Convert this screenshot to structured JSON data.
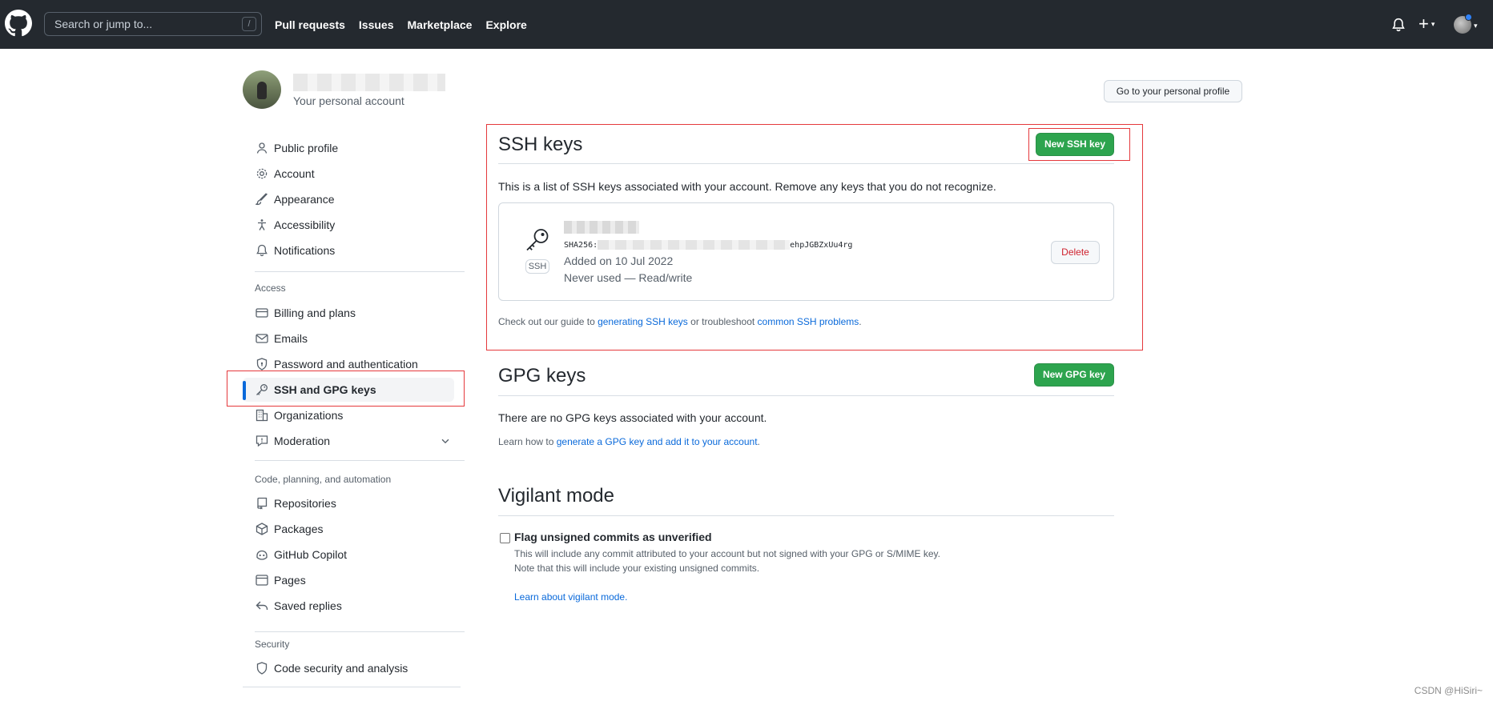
{
  "header": {
    "search_placeholder": "Search or jump to...",
    "search_shortcut": "/",
    "nav": [
      "Pull requests",
      "Issues",
      "Marketplace",
      "Explore"
    ],
    "plus_label": "+",
    "caret": "▾"
  },
  "account": {
    "subtitle": "Your personal account",
    "go_profile": "Go to your personal profile"
  },
  "sidebar": {
    "items_top": [
      {
        "label": "Public profile",
        "icon": "person-icon"
      },
      {
        "label": "Account",
        "icon": "gear-icon"
      },
      {
        "label": "Appearance",
        "icon": "paintbrush-icon"
      },
      {
        "label": "Accessibility",
        "icon": "accessibility-icon"
      },
      {
        "label": "Notifications",
        "icon": "bell-icon"
      }
    ],
    "group_access": "Access",
    "items_access": [
      {
        "label": "Billing and plans",
        "icon": "credit-card-icon"
      },
      {
        "label": "Emails",
        "icon": "mail-icon"
      },
      {
        "label": "Password and authentication",
        "icon": "shield-lock-icon"
      },
      {
        "label": "SSH and GPG keys",
        "icon": "key-icon"
      },
      {
        "label": "Organizations",
        "icon": "organization-icon"
      },
      {
        "label": "Moderation",
        "icon": "report-icon"
      }
    ],
    "group_code": "Code, planning, and automation",
    "items_code": [
      {
        "label": "Repositories",
        "icon": "repo-icon"
      },
      {
        "label": "Packages",
        "icon": "package-icon"
      },
      {
        "label": "GitHub Copilot",
        "icon": "copilot-icon"
      },
      {
        "label": "Pages",
        "icon": "browser-icon"
      },
      {
        "label": "Saved replies",
        "icon": "reply-icon"
      }
    ],
    "group_security": "Security",
    "items_security": [
      {
        "label": "Code security and analysis",
        "icon": "shield-icon"
      }
    ],
    "active": "SSH and GPG keys"
  },
  "ssh": {
    "title": "SSH keys",
    "new_button": "New SSH key",
    "description": "This is a list of SSH keys associated with your account. Remove any keys that you do not recognize.",
    "key": {
      "badge": "SSH",
      "fingerprint_prefix": "SHA256:",
      "fingerprint_suffix": "ehpJGBZxUu4rg",
      "added": "Added on 10 Jul 2022",
      "usage": "Never used — Read/write",
      "delete": "Delete"
    },
    "footer_pre": "Check out our guide to ",
    "footer_link1": "generating SSH keys",
    "footer_mid": " or troubleshoot ",
    "footer_link2": "common SSH problems",
    "footer_post": "."
  },
  "gpg": {
    "title": "GPG keys",
    "new_button": "New GPG key",
    "empty": "There are no GPG keys associated with your account.",
    "learn_pre": "Learn how to ",
    "learn_link": "generate a GPG key and add it to your account",
    "learn_post": "."
  },
  "vigilant": {
    "title": "Vigilant mode",
    "checkbox_label": "Flag unsigned commits as unverified",
    "checked": false,
    "desc1": "This will include any commit attributed to your account but not signed with your GPG or S/MIME key.",
    "desc2": "Note that this will include your existing unsigned commits.",
    "learn_link": "Learn about vigilant mode."
  },
  "watermark": "CSDN @HiSiri~",
  "colors": {
    "header_bg": "#24292f",
    "primary_button": "#2da44e",
    "link": "#0969da",
    "danger": "#cf222e",
    "annotation": "#e5393c"
  }
}
